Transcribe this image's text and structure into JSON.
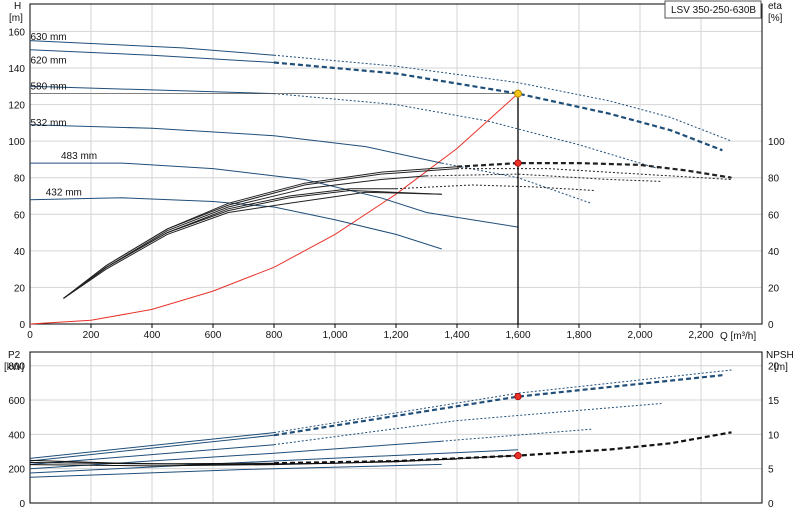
{
  "chart_data": [
    {
      "type": "line",
      "title": "LSV 350-250-630B",
      "ylabel": "H",
      "ylabel_unit": "[m]",
      "y2label": "eta",
      "y2label_unit": "[%]",
      "xlabel": "Q [m³/h]",
      "xlim": [
        0,
        2400
      ],
      "ylim": [
        0,
        175
      ],
      "y2lim": [
        0,
        175
      ],
      "grid": true,
      "xticks": [
        0,
        200,
        400,
        600,
        800,
        1000,
        1200,
        1400,
        1600,
        1800,
        2000,
        2200
      ],
      "xtick_labels": [
        "0",
        "200",
        "400",
        "600",
        "800",
        "1,000",
        "1,200",
        "1,400",
        "1,600",
        "1,800",
        "2,000",
        "2,200"
      ],
      "yticks": [
        0,
        20,
        40,
        60,
        80,
        100,
        120,
        140,
        160
      ],
      "y2ticks": [
        0,
        20,
        40,
        60,
        80,
        100
      ],
      "operating_point": {
        "q": 1600,
        "h": 126,
        "eta": 88
      },
      "head_series": [
        {
          "name": "630 mm",
          "label_at": [
            100,
            157
          ],
          "solid": [
            [
              0,
              155
            ],
            [
              500,
              151
            ],
            [
              800,
              147
            ]
          ],
          "thick_dashed": [],
          "dotted": [
            [
              800,
              147
            ],
            [
              1200,
              141
            ],
            [
              1600,
              132
            ],
            [
              1900,
              122
            ],
            [
              2100,
              113
            ],
            [
              2300,
              100
            ]
          ]
        },
        {
          "name": "620 mm",
          "label_at": [
            100,
            144
          ],
          "solid": [
            [
              0,
              150
            ],
            [
              400,
              147
            ],
            [
              800,
              143
            ]
          ],
          "thick_dashed": [
            [
              800,
              143
            ],
            [
              1200,
              137
            ],
            [
              1600,
              126
            ],
            [
              1900,
              115
            ],
            [
              2100,
              106
            ],
            [
              2270,
              95
            ]
          ],
          "dotted": []
        },
        {
          "name": "580 mm",
          "label_at": [
            100,
            130
          ],
          "solid": [
            [
              0,
              130
            ],
            [
              400,
              128
            ],
            [
              800,
              126
            ]
          ],
          "thick_dashed": [],
          "dotted": [
            [
              800,
              126
            ],
            [
              1200,
              120
            ],
            [
              1500,
              111
            ],
            [
              1800,
              98
            ],
            [
              2060,
              85
            ]
          ]
        },
        {
          "name": "532 mm",
          "label_at": [
            100,
            110
          ],
          "solid": [
            [
              0,
              109
            ],
            [
              400,
              107
            ],
            [
              800,
              103
            ],
            [
              1100,
              97
            ],
            [
              1350,
              88
            ]
          ],
          "thick_dashed": [],
          "dotted": [
            [
              1350,
              88
            ],
            [
              1600,
              80
            ],
            [
              1840,
              66
            ]
          ]
        },
        {
          "name": "483 mm",
          "label_at": [
            200,
            92
          ],
          "solid": [
            [
              0,
              88
            ],
            [
              300,
              88
            ],
            [
              600,
              85
            ],
            [
              900,
              79
            ],
            [
              1150,
              69
            ],
            [
              1300,
              61
            ],
            [
              1600,
              53
            ]
          ],
          "thick_dashed": [],
          "dotted": []
        },
        {
          "name": "432 mm",
          "label_at": [
            150,
            72
          ],
          "solid": [
            [
              0,
              68
            ],
            [
              300,
              69
            ],
            [
              600,
              67
            ],
            [
              800,
              64
            ],
            [
              1000,
              57
            ],
            [
              1200,
              49
            ],
            [
              1350,
              41
            ]
          ],
          "thick_dashed": [],
          "dotted": []
        }
      ],
      "efficiency_series": [
        {
          "name": "",
          "solid": [
            [
              110,
              14
            ],
            [
              250,
              32
            ],
            [
              450,
              52
            ],
            [
              650,
              66
            ],
            [
              900,
              77
            ],
            [
              1150,
              83
            ],
            [
              1400,
              86
            ]
          ],
          "thick_dashed": [
            [
              1400,
              86
            ],
            [
              1600,
              88
            ],
            [
              1800,
              88
            ],
            [
              2000,
              87
            ],
            [
              2150,
              84
            ],
            [
              2300,
              80
            ]
          ],
          "dotted": []
        },
        {
          "name": "",
          "solid": [
            [
              110,
              14
            ],
            [
              250,
              32
            ],
            [
              450,
              52
            ],
            [
              650,
              65
            ],
            [
              900,
              76
            ],
            [
              1150,
              82
            ],
            [
              1400,
              85
            ]
          ],
          "thick_dashed": [],
          "dotted": [
            [
              1400,
              85
            ],
            [
              1700,
              85
            ],
            [
              2000,
              82
            ],
            [
              2300,
              79
            ]
          ]
        },
        {
          "name": "",
          "solid": [
            [
              110,
              14
            ],
            [
              250,
              31
            ],
            [
              450,
              51
            ],
            [
              650,
              64
            ],
            [
              900,
              74
            ],
            [
              1150,
              79
            ],
            [
              1300,
              81
            ]
          ],
          "thick_dashed": [],
          "dotted": [
            [
              1300,
              81
            ],
            [
              1600,
              82
            ],
            [
              1900,
              79
            ],
            [
              2070,
              78
            ]
          ]
        },
        {
          "name": "",
          "solid": [
            [
              110,
              14
            ],
            [
              250,
              31
            ],
            [
              450,
              50
            ],
            [
              650,
              63
            ],
            [
              850,
              70
            ],
            [
              1050,
              74
            ],
            [
              1200,
              74
            ]
          ],
          "thick_dashed": [],
          "dotted": [
            [
              1200,
              74
            ],
            [
              1450,
              76
            ],
            [
              1650,
              75
            ],
            [
              1850,
              73
            ]
          ]
        },
        {
          "name": "",
          "solid": [
            [
              110,
              14
            ],
            [
              250,
              31
            ],
            [
              450,
              50
            ],
            [
              650,
              62
            ],
            [
              850,
              69
            ],
            [
              1050,
              73
            ],
            [
              1350,
              71
            ]
          ],
          "thick_dashed": [],
          "dotted": []
        },
        {
          "name": "",
          "solid": [
            [
              110,
              14
            ],
            [
              250,
              30
            ],
            [
              450,
              49
            ],
            [
              650,
              61
            ],
            [
              850,
              66
            ],
            [
              1100,
              72
            ],
            [
              1350,
              71
            ]
          ],
          "thick_dashed": [],
          "dotted": []
        }
      ],
      "system_curve": [
        [
          0,
          0
        ],
        [
          200,
          2
        ],
        [
          400,
          8
        ],
        [
          600,
          18
        ],
        [
          800,
          31
        ],
        [
          1000,
          49
        ],
        [
          1200,
          71
        ],
        [
          1400,
          96
        ],
        [
          1600,
          126
        ]
      ]
    },
    {
      "type": "line",
      "ylabel": "P2",
      "ylabel_unit": "[kW]",
      "y2label": "NPSH",
      "y2label_unit": "[m]",
      "xlim": [
        0,
        2400
      ],
      "ylim": [
        0,
        880
      ],
      "y2lim": [
        0,
        22
      ],
      "grid": true,
      "yticks": [
        0,
        200,
        400,
        600,
        800
      ],
      "y2ticks": [
        0,
        5,
        10,
        15,
        20
      ],
      "operating_point": {
        "q": 1600,
        "p2": 620,
        "npsh": 6.9
      },
      "power_series": [
        {
          "name": "",
          "solid": [
            [
              0,
              260
            ],
            [
              800,
              410
            ]
          ],
          "thick_dashed": [],
          "dotted": [
            [
              800,
              410
            ],
            [
              1600,
              640
            ],
            [
              2300,
              775
            ]
          ]
        },
        {
          "name": "",
          "solid": [
            [
              0,
              245
            ],
            [
              800,
              395
            ]
          ],
          "thick_dashed": [
            [
              800,
              395
            ],
            [
              1600,
              620
            ],
            [
              2270,
              745
            ]
          ],
          "dotted": []
        },
        {
          "name": "",
          "solid": [
            [
              0,
              225
            ],
            [
              800,
              340
            ]
          ],
          "thick_dashed": [],
          "dotted": [
            [
              800,
              340
            ],
            [
              1400,
              480
            ],
            [
              2070,
              580
            ]
          ]
        },
        {
          "name": "",
          "solid": [
            [
              0,
              200
            ],
            [
              800,
              290
            ],
            [
              1350,
              360
            ]
          ],
          "thick_dashed": [],
          "dotted": [
            [
              1350,
              360
            ],
            [
              1840,
              430
            ]
          ]
        },
        {
          "name": "",
          "solid": [
            [
              0,
              175
            ],
            [
              800,
              245
            ],
            [
              1600,
              310
            ]
          ],
          "thick_dashed": [],
          "dotted": []
        },
        {
          "name": "",
          "solid": [
            [
              0,
              150
            ],
            [
              700,
              195
            ],
            [
              1350,
              225
            ]
          ],
          "thick_dashed": [],
          "dotted": []
        }
      ],
      "npsh_series": [
        {
          "name": "",
          "solid": [
            [
              0,
              5.9
            ],
            [
              400,
              5.7
            ],
            [
              800,
              5.8
            ]
          ],
          "thick_dashed": [
            [
              800,
              5.8
            ],
            [
              1200,
              6.1
            ],
            [
              1600,
              6.9
            ],
            [
              1900,
              7.8
            ],
            [
              2100,
              8.7
            ],
            [
              2300,
              10.3
            ]
          ],
          "dotted": []
        },
        {
          "name": "",
          "solid": [
            [
              0,
              5.6
            ],
            [
              400,
              5.4
            ],
            [
              800,
              5.6
            ],
            [
              1200,
              6.0
            ],
            [
              1600,
              6.9
            ]
          ],
          "thick_dashed": [],
          "dotted": []
        },
        {
          "name": "",
          "solid": [
            [
              0,
              6.2
            ],
            [
              300,
              5.8
            ],
            [
              600,
              5.6
            ],
            [
              1000,
              5.8
            ],
            [
              1400,
              6.4
            ]
          ],
          "thick_dashed": [],
          "dotted": []
        }
      ]
    }
  ]
}
